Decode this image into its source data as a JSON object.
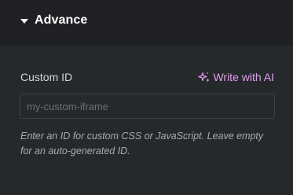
{
  "section": {
    "title": "Advance"
  },
  "field": {
    "label": "Custom ID",
    "ai_link_label": "Write with AI",
    "input_value": "",
    "input_placeholder": "my-custom-iframe",
    "help_text": "Enter an ID for custom CSS or JavaScript. Leave empty for an auto-generated ID."
  },
  "icons": {
    "toggle": "caret-down-icon",
    "ai": "sparkle-icon"
  },
  "colors": {
    "background": "#26292c",
    "header_background": "#1e2023",
    "ai_accent": "#e39cf0",
    "input_border": "#3f4247"
  }
}
